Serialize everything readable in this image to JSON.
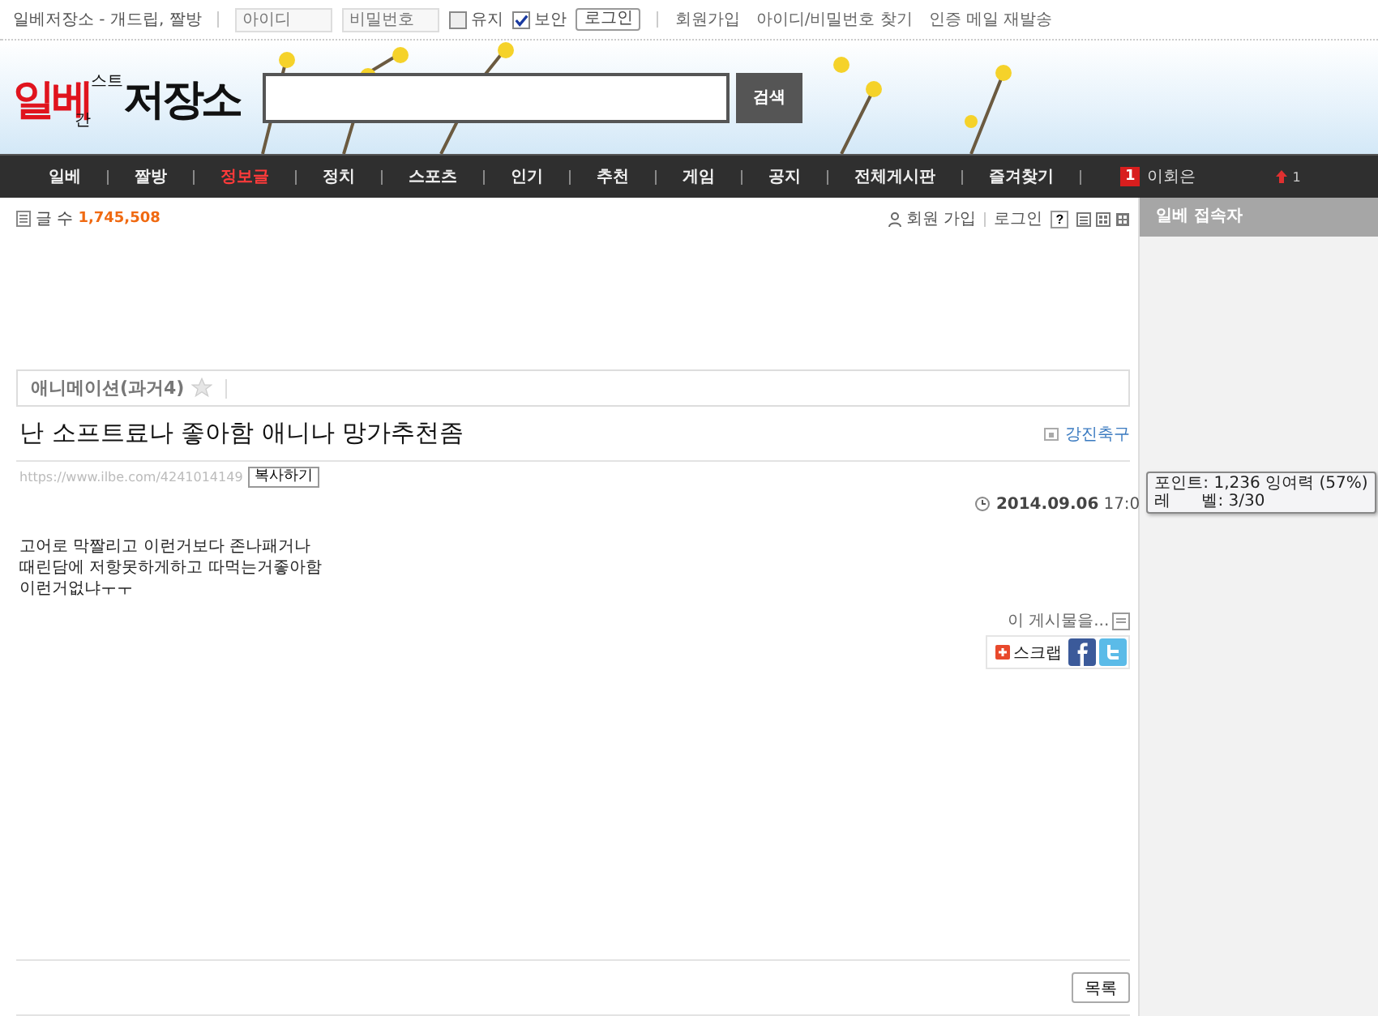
{
  "top_bar": {
    "site_title": "일베저장소 - 개드립, 짤방",
    "id_field": {
      "placeholder": "아이디"
    },
    "password_field": {
      "placeholder": "비밀번호"
    },
    "options": [
      {
        "label": "유지",
        "checked": false
      },
      {
        "label": "보안",
        "checked": true
      }
    ],
    "login_button": "로그인",
    "links": [
      "회원가입",
      "아이디/비밀번호 찾기",
      "인증 메일 재발송"
    ]
  },
  "header": {
    "logo": {
      "main": "일베",
      "small_bottom": "간",
      "small_top": "스트",
      "tail": "저장소"
    },
    "search_button": "검색"
  },
  "nav": {
    "items": [
      {
        "label": "일베",
        "selected": false
      },
      {
        "label": "짤방",
        "selected": false
      },
      {
        "label": "정보글",
        "selected": true
      },
      {
        "label": "정치",
        "selected": false
      },
      {
        "label": "스포츠",
        "selected": false
      },
      {
        "label": "인기",
        "selected": false
      },
      {
        "label": "추천",
        "selected": false
      },
      {
        "label": "게임",
        "selected": false
      },
      {
        "label": "공지",
        "selected": false
      },
      {
        "label": "전체게시판",
        "selected": false
      },
      {
        "label": "즐겨찾기",
        "selected": false
      }
    ],
    "notice": {
      "badge": "1",
      "label": "이회은"
    },
    "rank": "1"
  },
  "board_info": {
    "count_label": "글 수",
    "count": "1,745,508",
    "links": [
      "회원 가입",
      "로그인"
    ],
    "help": "?"
  },
  "sidebar": {
    "title": "일베 접속자"
  },
  "post": {
    "category": "애니메이션(과거4)",
    "title": "난 소프트료나 좋아함 애니나 망가추천좀",
    "author": "강진축구",
    "url": "https://www.ilbe.com/4241014149",
    "copy_button": "복사하기",
    "date": "2014.09.06",
    "time": "17:0",
    "tooltip": [
      "포인트: 1,236 잉여력 (57%)",
      "레      벨: 3/30"
    ],
    "body": [
      "고어로 막짤리고 이런거보다 존나패거나",
      "때린담에 저항못하게하고 따먹는거좋아함",
      "이런거없냐ㅜㅜ"
    ],
    "share_label": "이 게시물을...",
    "scrap_button": "스크랩",
    "list_button": "목록"
  }
}
